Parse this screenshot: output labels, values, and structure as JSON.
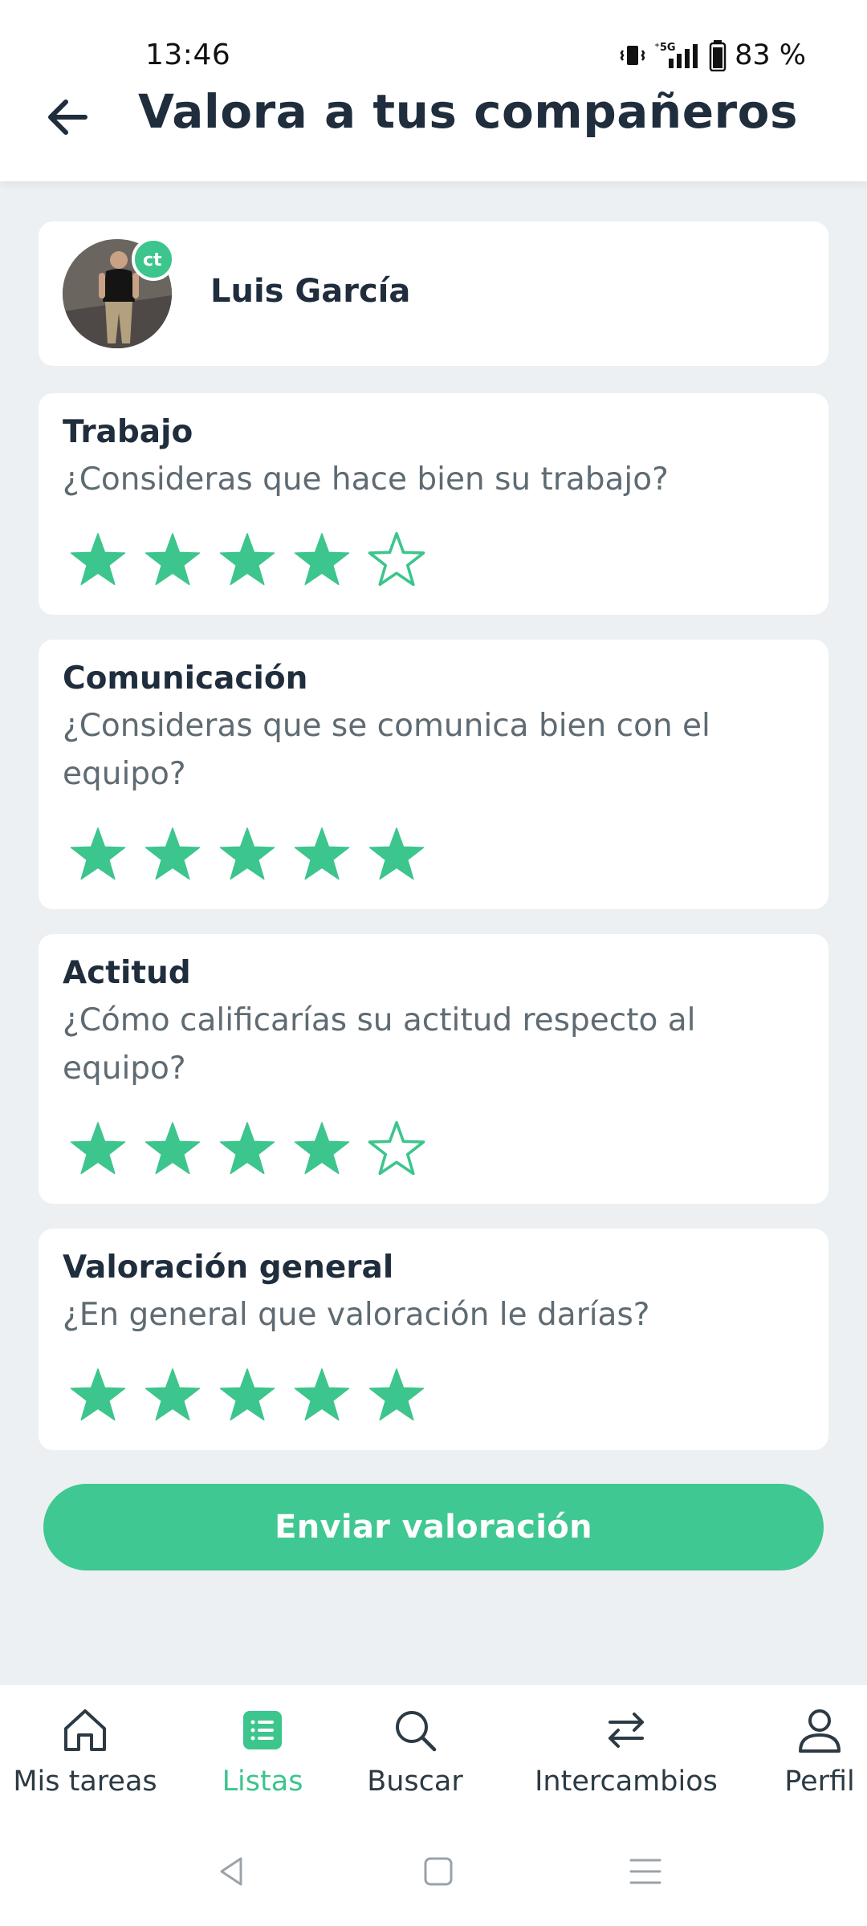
{
  "status_bar": {
    "time": "13:46",
    "network": "5G",
    "battery": "83 %"
  },
  "header": {
    "title": "Valora a tus compañeros",
    "back_icon": "arrow-left-icon"
  },
  "profile": {
    "name": "Luis García",
    "badge_icon": "team-badge-icon"
  },
  "ratings": [
    {
      "title": "Trabajo",
      "question": "¿Consideras que hace bien su trabajo?",
      "stars": 4,
      "max": 5
    },
    {
      "title": "Comunicación",
      "question": "¿Consideras que se comunica bien con el equipo?",
      "stars": 5,
      "max": 5
    },
    {
      "title": "Actitud",
      "question": "¿Cómo calificarías su actitud respecto al equipo?",
      "stars": 4,
      "max": 5
    },
    {
      "title": "Valoración general",
      "question": "¿En general que valoración le darías?",
      "stars": 5,
      "max": 5
    }
  ],
  "submit_label": "Enviar valoración",
  "bottom_nav": [
    {
      "label": "Mis tareas",
      "icon": "home-icon",
      "active": false
    },
    {
      "label": "Listas",
      "icon": "list-icon",
      "active": true
    },
    {
      "label": "Buscar",
      "icon": "search-icon",
      "active": false
    },
    {
      "label": "Intercambios",
      "icon": "swap-icon",
      "active": false
    },
    {
      "label": "Perfil",
      "icon": "user-icon",
      "active": false
    }
  ],
  "colors": {
    "accent": "#3cc58c",
    "title_text": "#1f2d3d",
    "question_text": "#5f6b73",
    "background": "#ecf0f3"
  }
}
